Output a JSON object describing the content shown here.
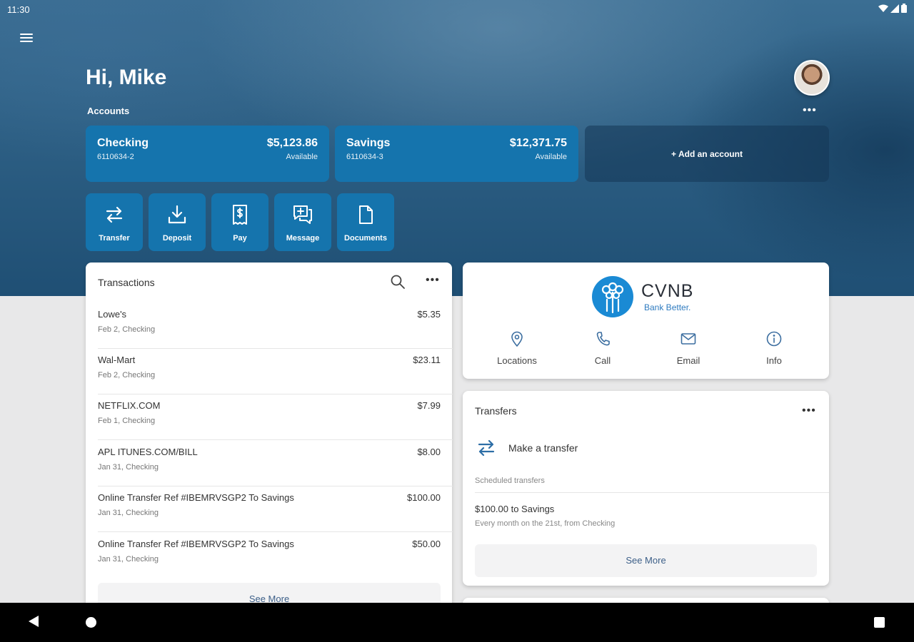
{
  "status_bar": {
    "time": "11:30"
  },
  "header": {
    "greeting": "Hi, Mike"
  },
  "accounts": {
    "label": "Accounts",
    "more": "•••",
    "items": [
      {
        "name": "Checking",
        "number": "6110634-2",
        "balance": "$5,123.86",
        "balance_label": "Available"
      },
      {
        "name": "Savings",
        "number": "6110634-3",
        "balance": "$12,371.75",
        "balance_label": "Available"
      }
    ],
    "add_label": "+ Add an account"
  },
  "actions": [
    {
      "label": "Transfer",
      "icon": "transfer-icon"
    },
    {
      "label": "Deposit",
      "icon": "deposit-icon"
    },
    {
      "label": "Pay",
      "icon": "pay-icon"
    },
    {
      "label": "Message",
      "icon": "message-icon"
    },
    {
      "label": "Documents",
      "icon": "documents-icon"
    }
  ],
  "transactions": {
    "title": "Transactions",
    "more": "•••",
    "items": [
      {
        "description": "Lowe's",
        "meta": "Feb 2, Checking",
        "amount": "$5.35"
      },
      {
        "description": "Wal-Mart",
        "meta": "Feb 2, Checking",
        "amount": "$23.11"
      },
      {
        "description": "NETFLIX.COM",
        "meta": "Feb 1, Checking",
        "amount": "$7.99"
      },
      {
        "description": "APL ITUNES.COM/BILL",
        "meta": "Jan 31, Checking",
        "amount": "$8.00"
      },
      {
        "description": "Online Transfer Ref #IBEMRVSGP2 To Savings",
        "meta": "Jan 31, Checking",
        "amount": "$100.00"
      },
      {
        "description": "Online Transfer Ref #IBEMRVSGP2 To Savings",
        "meta": "Jan 31, Checking",
        "amount": "$50.00"
      }
    ],
    "see_more": "See More"
  },
  "bank": {
    "name": "CVNB",
    "tagline": "Bank Better.",
    "brand_color": "#1a8ad4",
    "contacts": [
      {
        "label": "Locations",
        "icon": "location-pin-icon"
      },
      {
        "label": "Call",
        "icon": "phone-icon"
      },
      {
        "label": "Email",
        "icon": "email-icon"
      },
      {
        "label": "Info",
        "icon": "info-icon"
      }
    ]
  },
  "transfers": {
    "title": "Transfers",
    "more": "•••",
    "make_transfer": "Make a transfer",
    "scheduled_label": "Scheduled transfers",
    "scheduled": [
      {
        "title": "$100.00 to Savings",
        "subtitle": "Every month on the 21st, from Checking"
      }
    ],
    "see_more": "See More"
  },
  "colors": {
    "primary": "#1574ad",
    "hero_dark": "#1f4f74",
    "link": "#3c5f88"
  }
}
